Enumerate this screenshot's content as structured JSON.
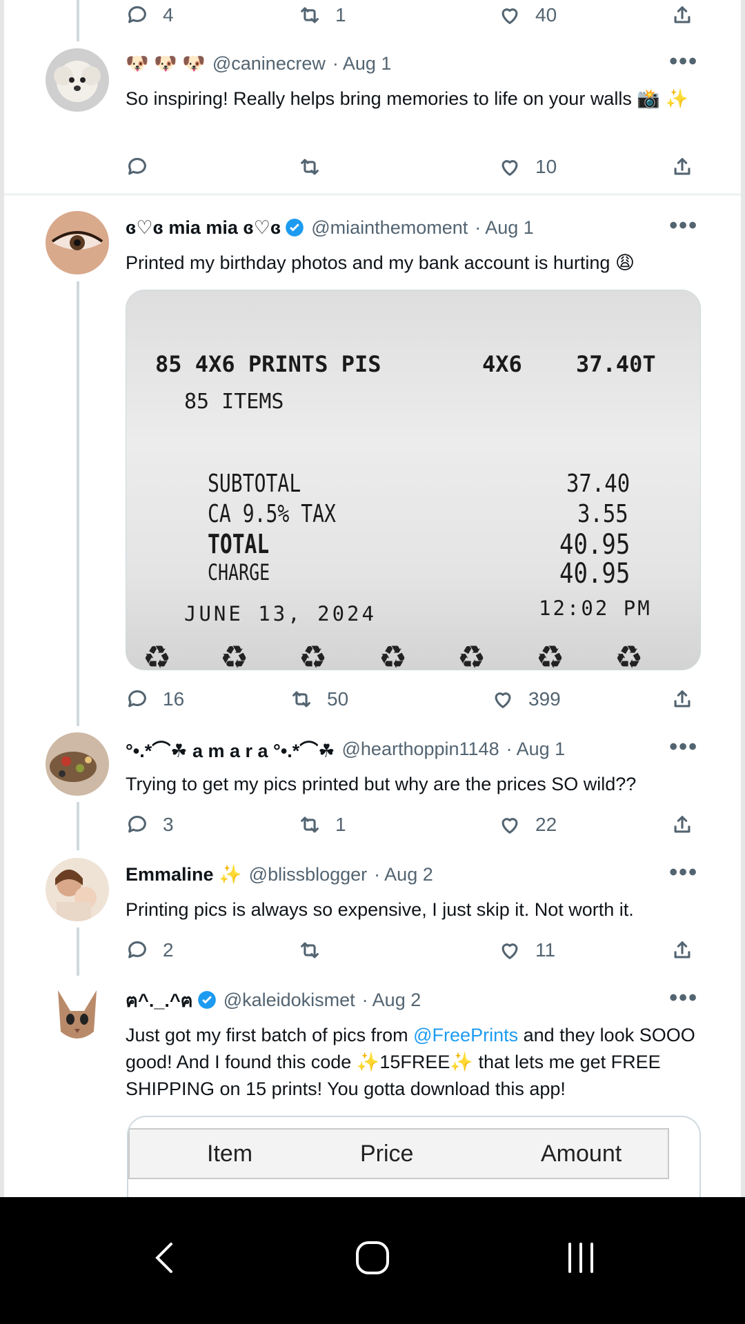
{
  "tweets": [
    {
      "actions": {
        "reply": "4",
        "retweet": "1",
        "like": "40"
      }
    },
    {
      "name": "🐶 🐶 🐶",
      "handle": "@caninecrew",
      "date": "· Aug 1",
      "text": "So inspiring! Really helps bring memories to life on your walls 📸 ✨",
      "actions": {
        "reply": "",
        "retweet": "",
        "like": "10"
      }
    },
    {
      "name": "ɞ♡ɞ mia mia ɞ♡ɞ",
      "handle": "@miainthemoment",
      "date": "· Aug 1",
      "verified": true,
      "text": "Printed my birthday photos and my bank account is hurting 😩",
      "actions": {
        "reply": "16",
        "retweet": "50",
        "like": "399"
      }
    },
    {
      "name": "°•.*⌒☘ a m a r a °•.*⌒☘",
      "handle": "@hearthoppin1148",
      "date": "· Aug 1",
      "text": "Trying to get my pics printed but why are the prices SO wild??",
      "actions": {
        "reply": "3",
        "retweet": "1",
        "like": "22"
      }
    },
    {
      "name": "Emmaline ✨",
      "handle": "@blissblogger",
      "date": "· Aug 2",
      "text": "Printing pics is always so expensive, I just skip it. Not worth it.",
      "actions": {
        "reply": "2",
        "retweet": "",
        "like": "11"
      }
    },
    {
      "name": "ฅ^._.^ฅ",
      "handle": "@kaleidokismet",
      "date": "· Aug 2",
      "verified": true,
      "text_part1": "Just got my first batch of pics from ",
      "mention": "@FreePrints",
      "text_part2": " and they look SOOO good! And I found this code ✨15FREE✨ that lets me get FREE SHIPPING on 15 prints! You gotta download this app!",
      "actions": {
        "reply": "",
        "retweet": "",
        "like": ""
      }
    }
  ],
  "receipt": {
    "line1_qty": "85",
    "line1_desc": "4X6 PRINTS PIS",
    "line1_size": "4X6",
    "line1_price": "37.40T",
    "items": "85 ITEMS",
    "subtotal_label": "SUBTOTAL",
    "subtotal": "37.40",
    "tax_label": "CA 9.5% TAX",
    "tax": "3.55",
    "total_label": "TOTAL",
    "total": "40.95",
    "charge_label": "CHARGE",
    "charge": "40.95",
    "date": "JUNE 13, 2024",
    "time": "12:02 PM",
    "recycle": "♻"
  },
  "table": {
    "col1": "Item",
    "col2": "Price",
    "col3": "Amount"
  },
  "more_label": "•••",
  "nav": {
    "back": "back-icon",
    "home": "home-icon",
    "recents": "recents-icon"
  },
  "colors": {
    "link": "#1d9bf0",
    "muted": "#536471",
    "verified": "#1d9bf0"
  }
}
